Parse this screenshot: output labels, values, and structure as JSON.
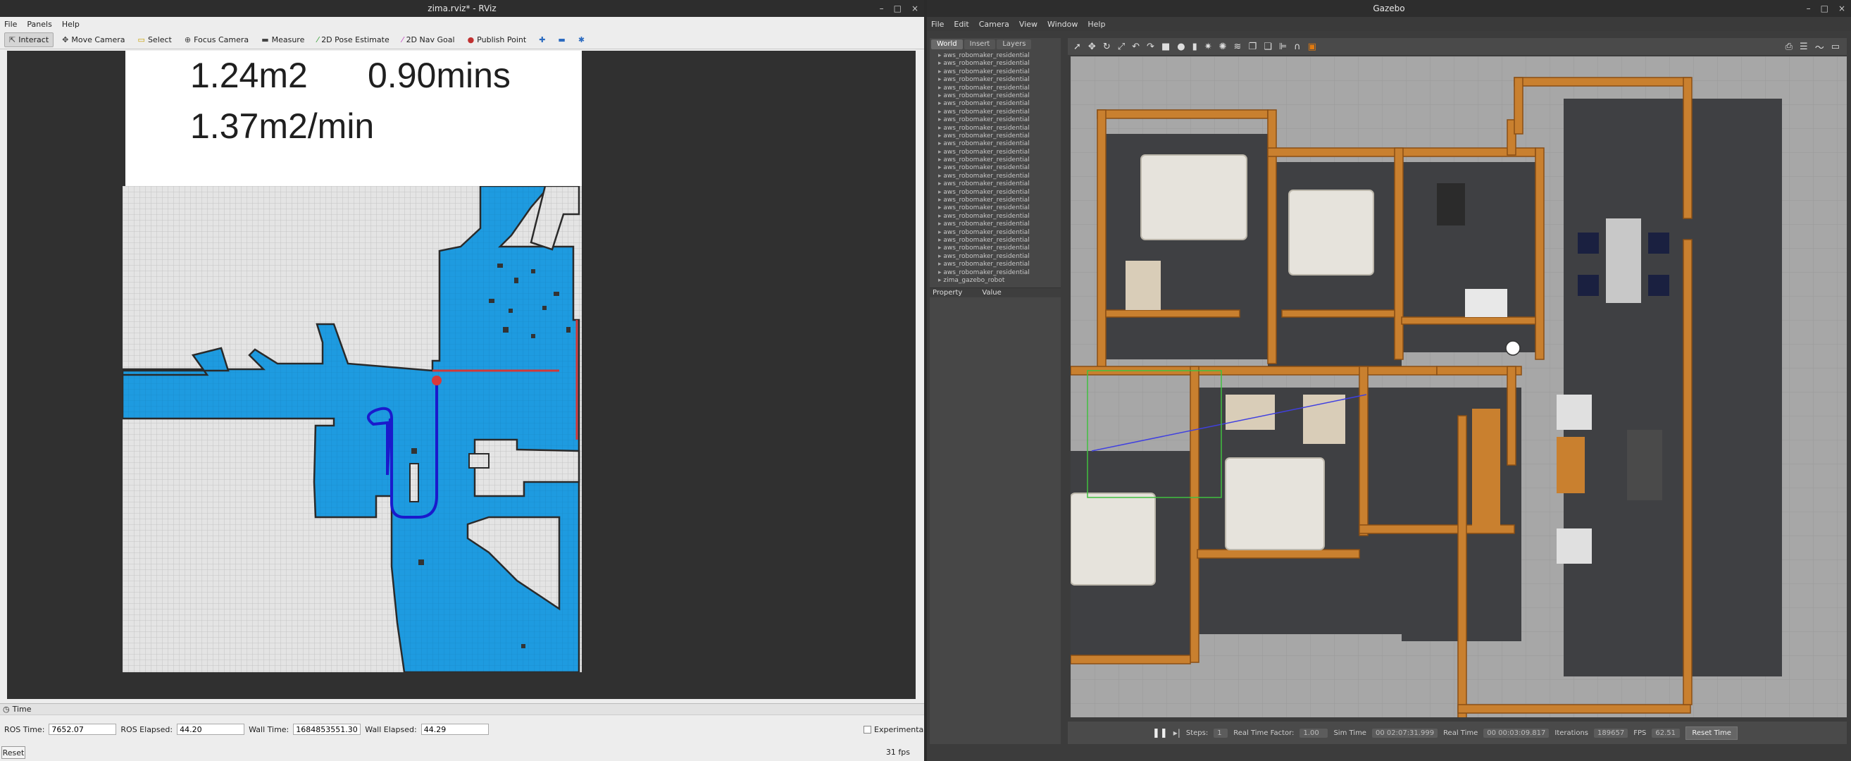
{
  "rviz": {
    "title": "zima.rviz* - RViz",
    "window_controls": [
      "–",
      "□",
      "×"
    ],
    "menu": [
      "File",
      "Panels",
      "Help"
    ],
    "tools": [
      {
        "label": "Interact",
        "icon": "interact-icon",
        "active": true
      },
      {
        "label": "Move Camera",
        "icon": "move-camera-icon"
      },
      {
        "label": "Select",
        "icon": "select-icon"
      },
      {
        "label": "Focus Camera",
        "icon": "focus-camera-icon"
      },
      {
        "label": "Measure",
        "icon": "measure-icon"
      },
      {
        "label": "2D Pose Estimate",
        "icon": "pose-estimate-icon"
      },
      {
        "label": "2D Nav Goal",
        "icon": "nav-goal-icon"
      },
      {
        "label": "Publish Point",
        "icon": "publish-point-icon"
      }
    ],
    "stats": {
      "area": "1.24m2",
      "time": "0.90mins",
      "rate": "1.37m2/min"
    },
    "time_panel": {
      "title": "Time",
      "ros_time_label": "ROS Time:",
      "ros_time": "7652.07",
      "ros_elapsed_label": "ROS Elapsed:",
      "ros_elapsed": "44.20",
      "wall_time_label": "Wall Time:",
      "wall_time": "1684853551.30",
      "wall_elapsed_label": "Wall Elapsed:",
      "wall_elapsed": "44.29",
      "experimental_label": "Experimental",
      "reset_label": "Reset",
      "fps": "31 fps"
    },
    "colors": {
      "explored": "#1e9be0",
      "path": "#1a1acc",
      "robot": "#d93a3a",
      "unknown": "#e6e6e6"
    }
  },
  "gazebo": {
    "title": "Gazebo",
    "window_controls": [
      "–",
      "□",
      "×"
    ],
    "menu": [
      "File",
      "Edit",
      "Camera",
      "View",
      "Window",
      "Help"
    ],
    "tabs": [
      "World",
      "Insert",
      "Layers"
    ],
    "tree_items_label": "aws_robomaker_residential",
    "tree_last_item": "zima_gazebo_robot",
    "property_header": "Property",
    "value_header": "Value",
    "bottom": {
      "steps_label": "Steps:",
      "steps": "1",
      "rtf_label": "Real Time Factor:",
      "rtf": "1.00",
      "sim_time_label": "Sim Time",
      "sim_time": "00 02:07:31.999",
      "real_time_label": "Real Time",
      "real_time": "00 00:03:09.817",
      "iterations_label": "Iterations",
      "iterations": "189657",
      "fps_label": "FPS",
      "fps": "62.51",
      "reset_time": "Reset Time"
    }
  }
}
